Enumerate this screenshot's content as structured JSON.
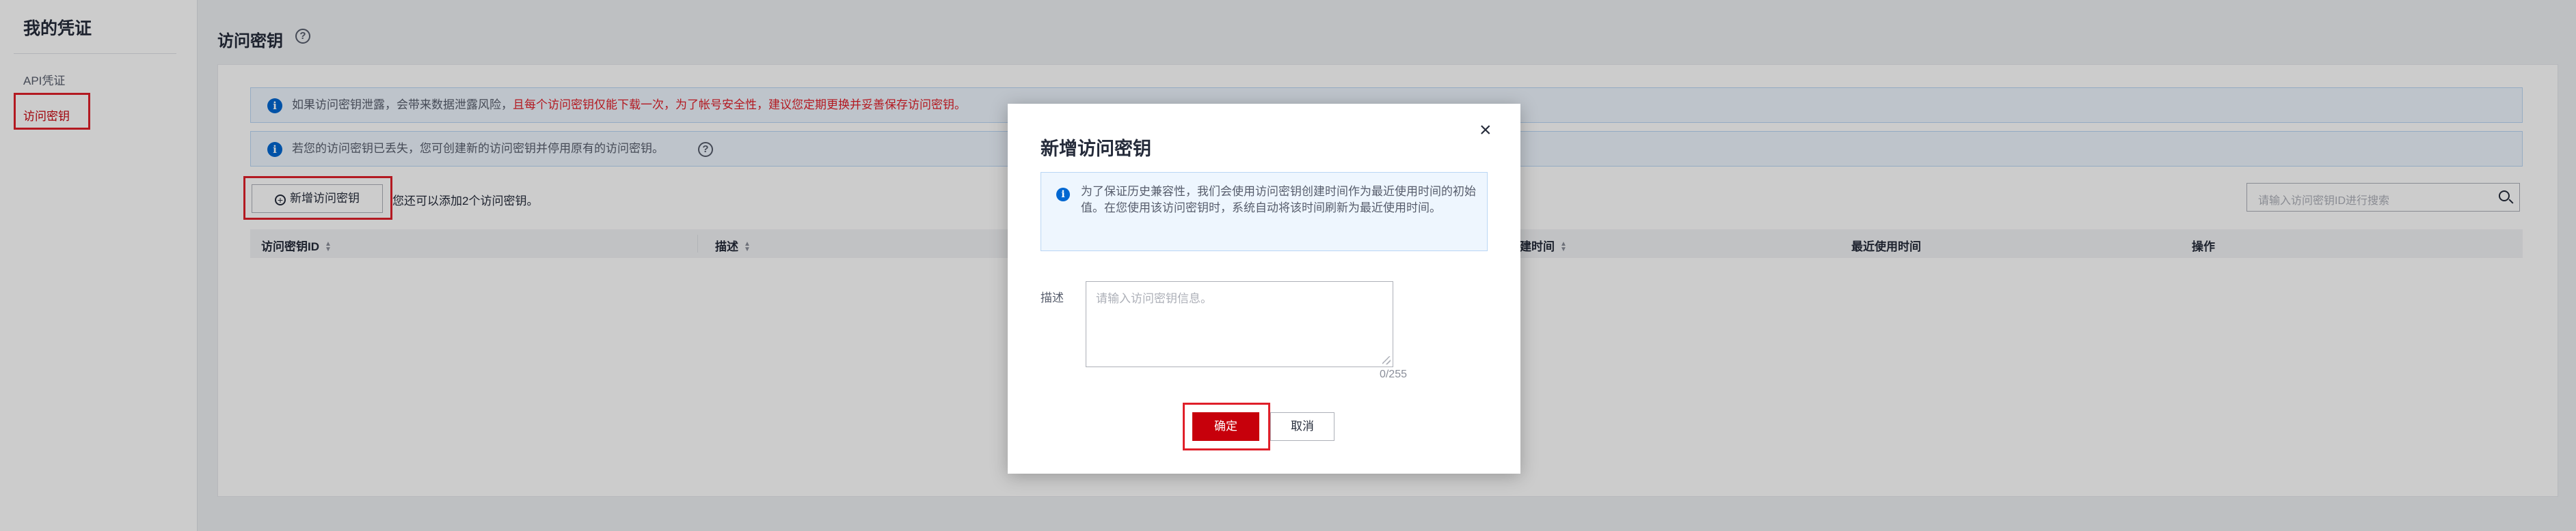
{
  "sidebar": {
    "title": "我的凭证",
    "items": [
      {
        "label": "API凭证",
        "active": false
      },
      {
        "label": "访问密钥",
        "active": true
      }
    ]
  },
  "page": {
    "title": "访问密钥",
    "help_icon": "question-circle-icon"
  },
  "alerts": {
    "first": {
      "text": "如果访问密钥泄露，会带来数据泄露风险，",
      "warning": "且每个访问密钥仅能下载一次，为了帐号安全性，建议您定期更换并妥善保存访问密钥。"
    },
    "second": {
      "text": "若您的访问密钥已丢失，您可创建新的访问密钥并停用原有的访问密钥。"
    }
  },
  "toolbar": {
    "add_button_label": "新增访问密钥",
    "quota_text": "您还可以添加2个访问密钥。",
    "search_placeholder": "请输入访问密钥ID进行搜索"
  },
  "table": {
    "columns": [
      {
        "label": "访问密钥ID",
        "sortable": true
      },
      {
        "label": "描述",
        "sortable": true
      },
      {
        "label": "创建时间",
        "sortable": true
      },
      {
        "label": "最近使用时间",
        "sortable": false
      },
      {
        "label": "操作",
        "sortable": false
      }
    ],
    "rows": []
  },
  "modal": {
    "title": "新增访问密钥",
    "close_icon": "close-icon",
    "note": "为了保证历史兼容性，我们会使用访问密钥创建时间作为最近使用时间的初始值。在您使用该访问密钥时，系统自动将该时间刷新为最近使用时间。",
    "description_label": "描述",
    "description_placeholder": "请输入访问密钥信息。",
    "description_value": "",
    "counter": "0/255",
    "ok_label": "确定",
    "cancel_label": "取消"
  },
  "colors": {
    "brand_red": "#c7000b",
    "highlight_box": "#e0202a",
    "info_blue": "#0067d1",
    "alert_bg": "#eef6fe"
  }
}
